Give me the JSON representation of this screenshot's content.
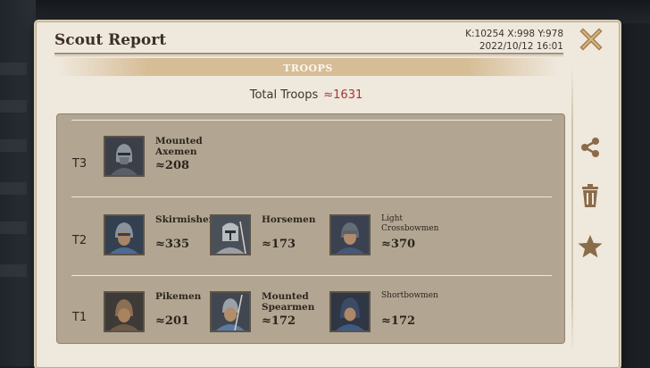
{
  "header": {
    "title": "Scout Report",
    "coords_line": "K:10254 X:998 Y:978",
    "datetime": "2022/10/12 16:01"
  },
  "section": {
    "label": "TROOPS"
  },
  "total": {
    "label": "Total Troops",
    "value": "≈1631"
  },
  "tiers": [
    {
      "label": "T3",
      "units": [
        {
          "name": "Mounted Axemen",
          "count": "≈208"
        }
      ]
    },
    {
      "label": "T2",
      "units": [
        {
          "name": "Skirmishers",
          "count": "≈335"
        },
        {
          "name": "Horsemen",
          "count": "≈173"
        },
        {
          "name": "Light Crossbowmen",
          "count": "≈370"
        }
      ]
    },
    {
      "label": "T1",
      "units": [
        {
          "name": "Pikemen",
          "count": "≈201"
        },
        {
          "name": "Mounted Spearmen",
          "count": "≈172"
        },
        {
          "name": "Shortbowmen",
          "count": "≈172"
        }
      ]
    }
  ],
  "actions": {
    "share_icon": "share-icon",
    "delete_icon": "trash-icon",
    "favorite_icon": "star-icon"
  },
  "colors": {
    "panel": "#efe8dc",
    "troop_box": "#b2a692",
    "accent_gold": "#d6bd96",
    "total_value": "#a8343a",
    "icon_brown": "#8a6b4a"
  }
}
